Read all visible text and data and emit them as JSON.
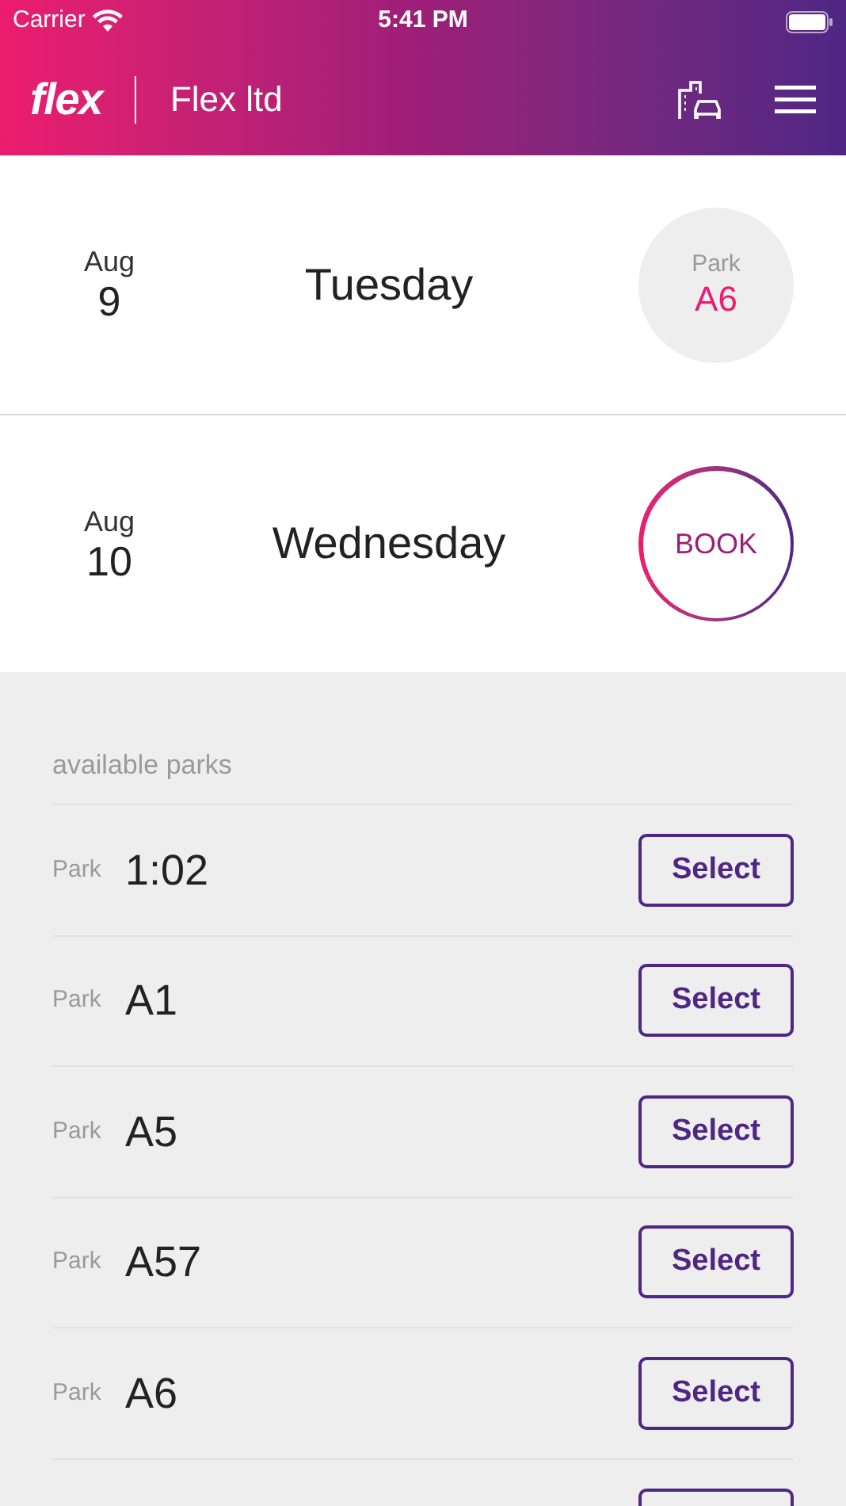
{
  "status_bar": {
    "carrier": "Carrier",
    "time": "5:41 PM"
  },
  "header": {
    "logo": "flex",
    "company": "Flex ltd"
  },
  "days": [
    {
      "kind": "booked",
      "month": "Aug",
      "day": "9",
      "weekday": "Tuesday",
      "park_label": "Park",
      "park": "A6"
    },
    {
      "kind": "book",
      "month": "Aug",
      "day": "10",
      "weekday": "Wednesday",
      "button": "BOOK"
    }
  ],
  "parks_heading": "available parks",
  "parks": [
    {
      "kind": "row",
      "label": "Park",
      "name": "1:02",
      "button": "Select"
    },
    {
      "kind": "row",
      "label": "Park",
      "name": "A1",
      "button": "Select"
    },
    {
      "kind": "row",
      "label": "Park",
      "name": "A5",
      "button": "Select"
    },
    {
      "kind": "row",
      "label": "Park",
      "name": "A57",
      "button": "Select"
    },
    {
      "kind": "row",
      "label": "Park",
      "name": "A6",
      "button": "Select"
    },
    {
      "kind": "cut"
    }
  ]
}
